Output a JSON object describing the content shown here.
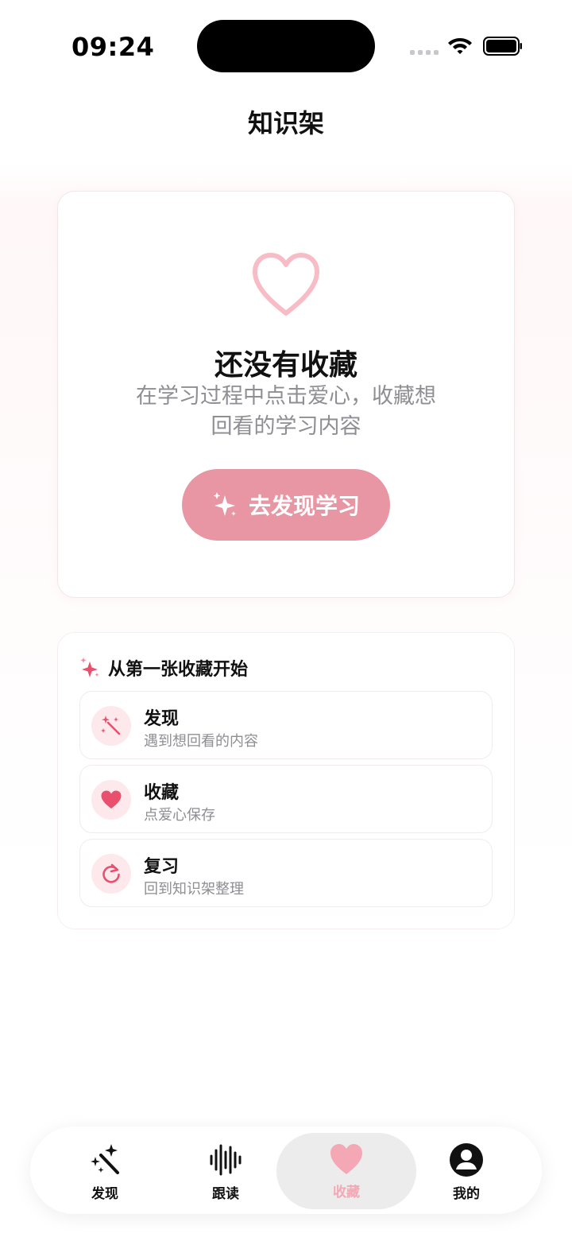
{
  "status_bar": {
    "time": "09:24"
  },
  "nav": {
    "title": "知识架"
  },
  "empty_state": {
    "title": "还没有收藏",
    "subtitle": "在学习过程中点击爱心，收藏想回看的学习内容",
    "cta_label": "去发现学习"
  },
  "guide": {
    "heading": "从第一张收藏开始",
    "steps": [
      {
        "title": "发现",
        "desc": "遇到想回看的内容",
        "icon": "magic-wand-icon"
      },
      {
        "title": "收藏",
        "desc": "点爱心保存",
        "icon": "heart-icon"
      },
      {
        "title": "复习",
        "desc": "回到知识架整理",
        "icon": "refresh-icon"
      }
    ]
  },
  "tabs": [
    {
      "label": "发现",
      "icon": "magic-wand-icon"
    },
    {
      "label": "跟读",
      "icon": "waveform-icon"
    },
    {
      "label": "收藏",
      "icon": "heart-icon",
      "active": true
    },
    {
      "label": "我的",
      "icon": "person-icon"
    }
  ],
  "colors": {
    "accent": "#e896a4",
    "active_tab": "#f4a7b5",
    "heart": "#e8506e"
  }
}
